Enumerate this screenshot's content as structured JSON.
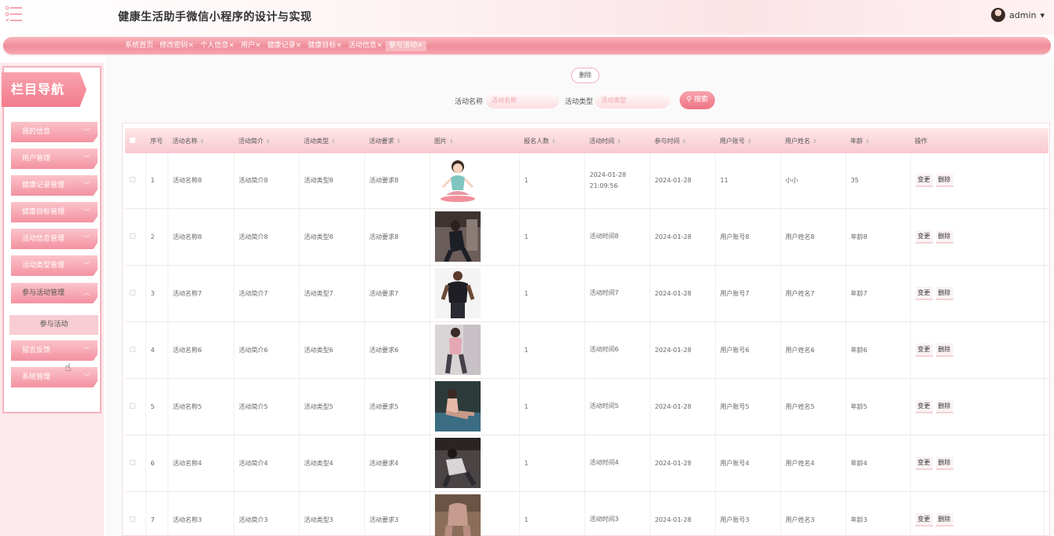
{
  "app": {
    "title": "健康生活助手微信小程序的设计与实现",
    "user": "admin"
  },
  "tabs": [
    {
      "label": "系统首页"
    },
    {
      "label": "修改密码×"
    },
    {
      "label": "个人信息×"
    },
    {
      "label": "用户×"
    },
    {
      "label": "健康记录×"
    },
    {
      "label": "健康目标×"
    },
    {
      "label": "活动信息×"
    },
    {
      "label": "参与活动×",
      "active": true
    }
  ],
  "sidebar": {
    "banner": "栏目导航",
    "items": [
      {
        "label": "我的信息",
        "chevron": "﹀"
      },
      {
        "label": "用户管理",
        "chevron": "﹀"
      },
      {
        "label": "健康记录管理",
        "chevron": "﹀"
      },
      {
        "label": "健康目标管理",
        "chevron": "﹀"
      },
      {
        "label": "活动信息管理",
        "chevron": "﹀"
      },
      {
        "label": "活动类型管理",
        "chevron": "﹀"
      },
      {
        "label": "参与活动管理",
        "chevron": "︿"
      },
      {
        "label": "留言反馈",
        "chevron": "﹀"
      },
      {
        "label": "系统管理",
        "chevron": "﹀"
      }
    ],
    "sub_item": "参与活动"
  },
  "toolbar": {
    "delete_label": "删除",
    "name_label": "活动名称",
    "name_placeholder": "活动名称",
    "type_label": "活动类型",
    "type_placeholder": "活动类型",
    "search_label": "搜索",
    "search_icon": "search-icon"
  },
  "table": {
    "columns": [
      "序号",
      "活动名称",
      "活动简介",
      "活动类型",
      "活动要求",
      "图片",
      "报名人数",
      "活动时间",
      "参与时间",
      "用户账号",
      "用户姓名",
      "年龄",
      "操作"
    ],
    "sortable": [
      false,
      true,
      true,
      true,
      true,
      true,
      true,
      true,
      true,
      true,
      true,
      true,
      false
    ],
    "rows": [
      {
        "idx": "1",
        "name": "活动名称8",
        "intro": "活动简介8",
        "type": "活动类型8",
        "req": "活动要求8",
        "count": "1",
        "time": "2024-01-28 21:09:56",
        "join": "2024-01-28",
        "account": "11",
        "uname": "小小",
        "age": "35",
        "img": "cartoon-yoga"
      },
      {
        "idx": "2",
        "name": "活动名称8",
        "intro": "活动简介8",
        "type": "活动类型8",
        "req": "活动要求8",
        "count": "1",
        "time": "活动时间8",
        "join": "2024-01-28",
        "account": "用户账号8",
        "uname": "用户姓名8",
        "age": "年龄8",
        "img": "gym-woman"
      },
      {
        "idx": "3",
        "name": "活动名称7",
        "intro": "活动简介7",
        "type": "活动类型7",
        "req": "活动要求7",
        "count": "1",
        "time": "活动时间7",
        "join": "2024-01-28",
        "account": "用户账号7",
        "uname": "用户姓名7",
        "age": "年龄7",
        "img": "gym-man"
      },
      {
        "idx": "4",
        "name": "活动名称6",
        "intro": "活动简介6",
        "type": "活动类型6",
        "req": "活动要求6",
        "count": "1",
        "time": "活动时间6",
        "join": "2024-01-28",
        "account": "用户账号6",
        "uname": "用户姓名6",
        "age": "年龄6",
        "img": "pink-outfit"
      },
      {
        "idx": "5",
        "name": "活动名称5",
        "intro": "活动简介5",
        "type": "活动类型5",
        "req": "活动要求5",
        "count": "1",
        "time": "活动时间5",
        "join": "2024-01-28",
        "account": "用户账号5",
        "uname": "用户姓名5",
        "age": "年龄5",
        "img": "stretch"
      },
      {
        "idx": "6",
        "name": "活动名称4",
        "intro": "活动简介4",
        "type": "活动类型4",
        "req": "活动要求4",
        "count": "1",
        "time": "活动时间4",
        "join": "2024-01-28",
        "account": "用户账号4",
        "uname": "用户姓名4",
        "age": "年龄4",
        "img": "squat"
      },
      {
        "idx": "7",
        "name": "活动名称3",
        "intro": "活动简介3",
        "type": "活动类型3",
        "req": "活动要求3",
        "count": "1",
        "time": "活动时间3",
        "join": "2024-01-28",
        "account": "用户账号3",
        "uname": "用户姓名3",
        "age": "年龄3",
        "img": "leggings"
      }
    ],
    "actions": {
      "edit": "变更",
      "delete": "删除"
    }
  },
  "colors": {
    "accent": "#ee7483",
    "tab_bar": "#f4a0aa",
    "header_bg": "#fbe3e6"
  }
}
